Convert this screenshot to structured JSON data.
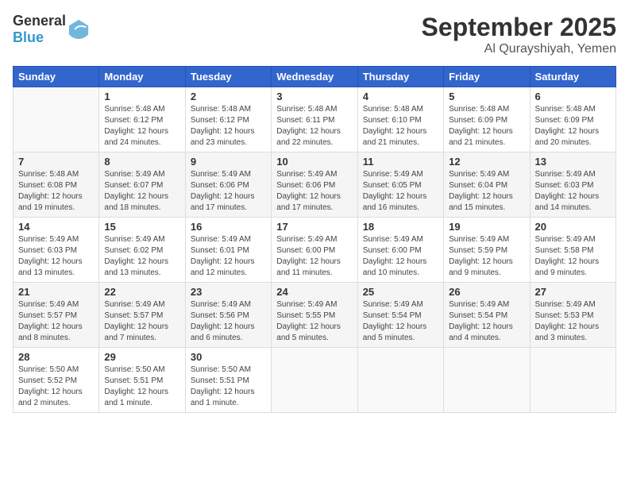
{
  "header": {
    "logo_general": "General",
    "logo_blue": "Blue",
    "month": "September 2025",
    "location": "Al Qurayshiyah, Yemen"
  },
  "days_of_week": [
    "Sunday",
    "Monday",
    "Tuesday",
    "Wednesday",
    "Thursday",
    "Friday",
    "Saturday"
  ],
  "weeks": [
    [
      {
        "day": null
      },
      {
        "day": 1,
        "sunrise": "5:48 AM",
        "sunset": "6:12 PM",
        "daylight": "12 hours and 24 minutes."
      },
      {
        "day": 2,
        "sunrise": "5:48 AM",
        "sunset": "6:12 PM",
        "daylight": "12 hours and 23 minutes."
      },
      {
        "day": 3,
        "sunrise": "5:48 AM",
        "sunset": "6:11 PM",
        "daylight": "12 hours and 22 minutes."
      },
      {
        "day": 4,
        "sunrise": "5:48 AM",
        "sunset": "6:10 PM",
        "daylight": "12 hours and 21 minutes."
      },
      {
        "day": 5,
        "sunrise": "5:48 AM",
        "sunset": "6:09 PM",
        "daylight": "12 hours and 21 minutes."
      },
      {
        "day": 6,
        "sunrise": "5:48 AM",
        "sunset": "6:09 PM",
        "daylight": "12 hours and 20 minutes."
      }
    ],
    [
      {
        "day": 7,
        "sunrise": "5:48 AM",
        "sunset": "6:08 PM",
        "daylight": "12 hours and 19 minutes."
      },
      {
        "day": 8,
        "sunrise": "5:49 AM",
        "sunset": "6:07 PM",
        "daylight": "12 hours and 18 minutes."
      },
      {
        "day": 9,
        "sunrise": "5:49 AM",
        "sunset": "6:06 PM",
        "daylight": "12 hours and 17 minutes."
      },
      {
        "day": 10,
        "sunrise": "5:49 AM",
        "sunset": "6:06 PM",
        "daylight": "12 hours and 17 minutes."
      },
      {
        "day": 11,
        "sunrise": "5:49 AM",
        "sunset": "6:05 PM",
        "daylight": "12 hours and 16 minutes."
      },
      {
        "day": 12,
        "sunrise": "5:49 AM",
        "sunset": "6:04 PM",
        "daylight": "12 hours and 15 minutes."
      },
      {
        "day": 13,
        "sunrise": "5:49 AM",
        "sunset": "6:03 PM",
        "daylight": "12 hours and 14 minutes."
      }
    ],
    [
      {
        "day": 14,
        "sunrise": "5:49 AM",
        "sunset": "6:03 PM",
        "daylight": "12 hours and 13 minutes."
      },
      {
        "day": 15,
        "sunrise": "5:49 AM",
        "sunset": "6:02 PM",
        "daylight": "12 hours and 13 minutes."
      },
      {
        "day": 16,
        "sunrise": "5:49 AM",
        "sunset": "6:01 PM",
        "daylight": "12 hours and 12 minutes."
      },
      {
        "day": 17,
        "sunrise": "5:49 AM",
        "sunset": "6:00 PM",
        "daylight": "12 hours and 11 minutes."
      },
      {
        "day": 18,
        "sunrise": "5:49 AM",
        "sunset": "6:00 PM",
        "daylight": "12 hours and 10 minutes."
      },
      {
        "day": 19,
        "sunrise": "5:49 AM",
        "sunset": "5:59 PM",
        "daylight": "12 hours and 9 minutes."
      },
      {
        "day": 20,
        "sunrise": "5:49 AM",
        "sunset": "5:58 PM",
        "daylight": "12 hours and 9 minutes."
      }
    ],
    [
      {
        "day": 21,
        "sunrise": "5:49 AM",
        "sunset": "5:57 PM",
        "daylight": "12 hours and 8 minutes."
      },
      {
        "day": 22,
        "sunrise": "5:49 AM",
        "sunset": "5:57 PM",
        "daylight": "12 hours and 7 minutes."
      },
      {
        "day": 23,
        "sunrise": "5:49 AM",
        "sunset": "5:56 PM",
        "daylight": "12 hours and 6 minutes."
      },
      {
        "day": 24,
        "sunrise": "5:49 AM",
        "sunset": "5:55 PM",
        "daylight": "12 hours and 5 minutes."
      },
      {
        "day": 25,
        "sunrise": "5:49 AM",
        "sunset": "5:54 PM",
        "daylight": "12 hours and 5 minutes."
      },
      {
        "day": 26,
        "sunrise": "5:49 AM",
        "sunset": "5:54 PM",
        "daylight": "12 hours and 4 minutes."
      },
      {
        "day": 27,
        "sunrise": "5:49 AM",
        "sunset": "5:53 PM",
        "daylight": "12 hours and 3 minutes."
      }
    ],
    [
      {
        "day": 28,
        "sunrise": "5:50 AM",
        "sunset": "5:52 PM",
        "daylight": "12 hours and 2 minutes."
      },
      {
        "day": 29,
        "sunrise": "5:50 AM",
        "sunset": "5:51 PM",
        "daylight": "12 hours and 1 minute."
      },
      {
        "day": 30,
        "sunrise": "5:50 AM",
        "sunset": "5:51 PM",
        "daylight": "12 hours and 1 minute."
      },
      {
        "day": null
      },
      {
        "day": null
      },
      {
        "day": null
      },
      {
        "day": null
      }
    ]
  ],
  "labels": {
    "sunrise": "Sunrise:",
    "sunset": "Sunset:",
    "daylight": "Daylight:"
  }
}
